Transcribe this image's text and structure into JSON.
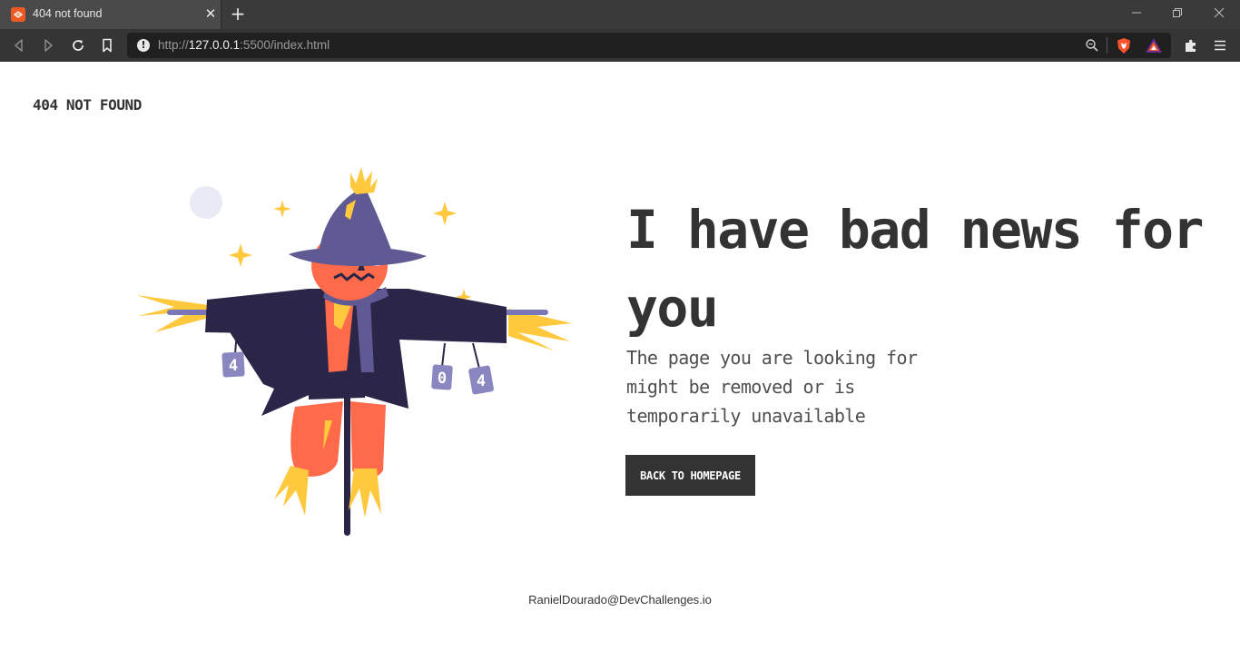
{
  "browser": {
    "tab": {
      "title": "404 not found",
      "favicon_color": "#ee5a24",
      "close_icon": "close-icon"
    },
    "new_tab_icon": "plus-icon",
    "window_controls": [
      "minimize-icon",
      "restore-icon",
      "close-icon"
    ],
    "nav_icons": [
      "back-icon",
      "forward-icon",
      "reload-icon",
      "bookmark-icon"
    ],
    "url": {
      "scheme": "http://",
      "host": "127.0.0.1",
      "path": ":5500/index.html",
      "security_icon": "info-icon"
    },
    "right_icons": [
      "zoom-icon",
      "brave-shield-icon",
      "brave-rewards-icon",
      "extensions-icon",
      "menu-icon"
    ]
  },
  "page": {
    "brand": "404 NOT FOUND",
    "headline": "I have bad news for you",
    "subtext": "The page you are looking for might be removed or is temporarily unavailable",
    "button_label": "BACK TO HOMEPAGE",
    "footer": "RanielDourado@DevChallenges.io",
    "illustration": {
      "description_icon": "scarecrow-illustration",
      "can_labels": [
        "4",
        "0",
        "4"
      ]
    },
    "colors": {
      "text_dark": "#333333",
      "text_sub": "#4f4f4f",
      "button_bg": "#333333",
      "hat": "#5f5a94",
      "coat": "#2b2547",
      "pumpkin": "#ff6b4a",
      "straw": "#ffc83d",
      "moon": "#e8ebf5"
    }
  }
}
